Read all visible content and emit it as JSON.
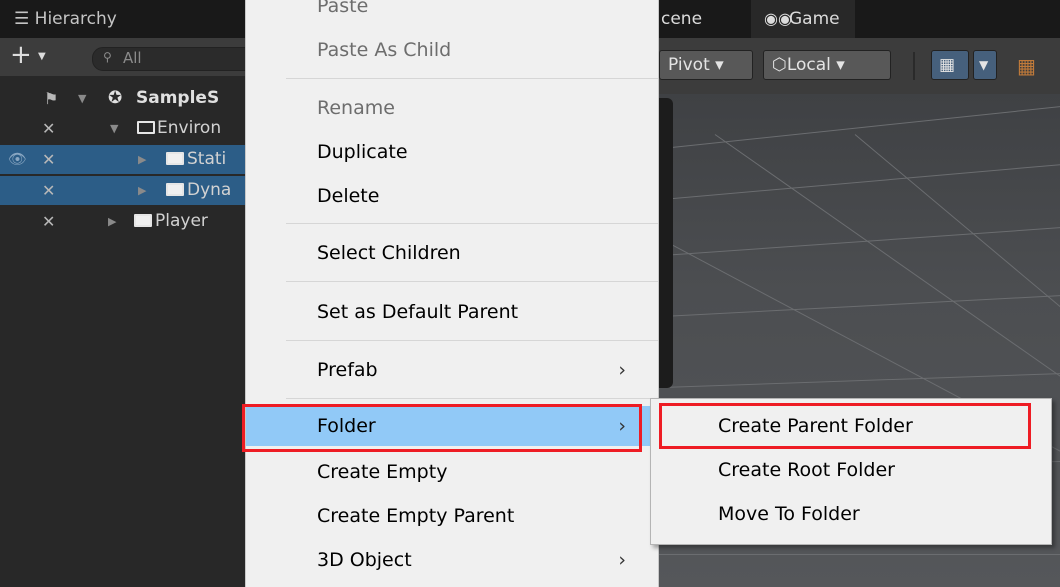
{
  "hierarchy": {
    "title": "Hierarchy",
    "search_placeholder": "All",
    "rows": [
      {
        "label": "SampleS"
      },
      {
        "label": "Environ"
      },
      {
        "label": "Stati"
      },
      {
        "label": "Dyna"
      },
      {
        "label": "Player"
      }
    ]
  },
  "scene": {
    "tab_scene": "cene",
    "tab_game": "Game",
    "pivot": "Pivot ▾",
    "local": "Local ▾"
  },
  "menu": {
    "items": [
      {
        "label": "Paste",
        "disabled": true
      },
      {
        "label": "Paste As Child",
        "disabled": true
      },
      {
        "label": "Rename",
        "disabled": true
      },
      {
        "label": "Duplicate"
      },
      {
        "label": "Delete"
      },
      {
        "label": "Select Children"
      },
      {
        "label": "Set as Default Parent"
      },
      {
        "label": "Prefab",
        "submenu": true
      },
      {
        "label": "Folder",
        "submenu": true,
        "highlighted": true
      },
      {
        "label": "Create Empty"
      },
      {
        "label": "Create Empty Parent"
      },
      {
        "label": "3D Object",
        "submenu": true
      }
    ],
    "chevron": "›"
  },
  "submenu": {
    "items": [
      {
        "label": "Create Parent Folder"
      },
      {
        "label": "Create Root Folder"
      },
      {
        "label": "Move To Folder"
      }
    ]
  },
  "colors": {
    "highlight": "#91c9f7",
    "annotation": "#ee1c24",
    "selection": "#2c5d87"
  }
}
